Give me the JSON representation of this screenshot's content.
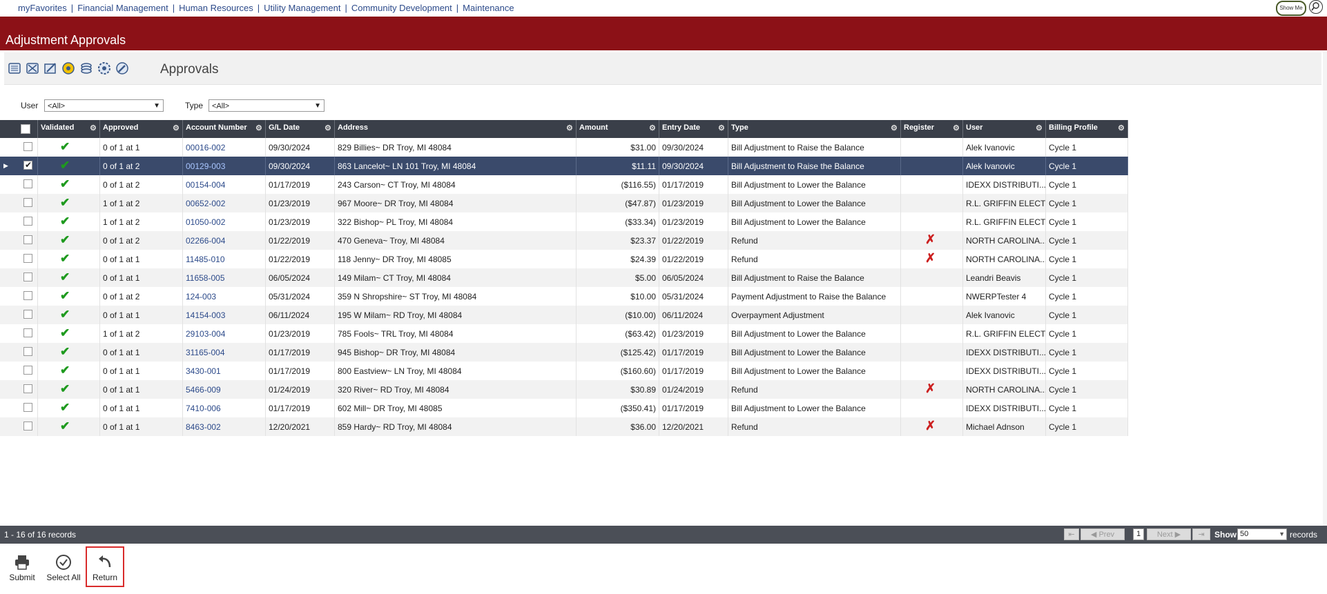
{
  "topnav": {
    "links": [
      "myFavorites",
      "Financial Management",
      "Human Resources",
      "Utility Management",
      "Community Development",
      "Maintenance"
    ],
    "show_me": "Show Me"
  },
  "title": "Adjustment Approvals",
  "toolbar": {
    "label": "Approvals",
    "icons": [
      "list-icon",
      "filter-icon",
      "edit-icon",
      "settings-icon",
      "stack-icon",
      "gear-icon",
      "tools-icon"
    ]
  },
  "filters": {
    "user_label": "User",
    "user_value": "<All>",
    "type_label": "Type",
    "type_value": "<All>"
  },
  "grid": {
    "columns": [
      "Validated",
      "Approved",
      "Account Number",
      "G/L Date",
      "Address",
      "Amount",
      "Entry Date",
      "Type",
      "Register",
      "User",
      "Billing Profile"
    ],
    "rows": [
      {
        "approved": "0 of 1 at 1",
        "account": "00016-002",
        "gl_date": "09/30/2024",
        "address": "829 Billies~ DR Troy, MI 48084",
        "amount": "$31.00",
        "entry_date": "09/30/2024",
        "type": "Bill Adjustment to Raise the Balance",
        "register_flag": false,
        "user": "Alek Ivanovic",
        "billing": "Cycle 1",
        "selected": false
      },
      {
        "approved": "0 of 1 at 2",
        "account": "00129-003",
        "gl_date": "09/30/2024",
        "address": "863 Lancelot~ LN 101 Troy, MI 48084",
        "amount": "$11.11",
        "entry_date": "09/30/2024",
        "type": "Bill Adjustment to Raise the Balance",
        "register_flag": false,
        "user": "Alek Ivanovic",
        "billing": "Cycle 1",
        "selected": true
      },
      {
        "approved": "0 of 1 at 2",
        "account": "00154-004",
        "gl_date": "01/17/2019",
        "address": "243 Carson~ CT Troy, MI 48084",
        "amount": "($116.55)",
        "entry_date": "01/17/2019",
        "type": "Bill Adjustment to Lower the Balance",
        "register_flag": false,
        "user": "IDEXX DISTRIBUTI...",
        "billing": "Cycle 1",
        "selected": false
      },
      {
        "approved": "1 of 1 at 2",
        "account": "00652-002",
        "gl_date": "01/23/2019",
        "address": "967 Moore~ DR Troy, MI 48084",
        "amount": "($47.87)",
        "entry_date": "01/23/2019",
        "type": "Bill Adjustment to Lower the Balance",
        "register_flag": false,
        "user": "R.L. GRIFFIN ELECTRI",
        "billing": "Cycle 1",
        "selected": false
      },
      {
        "approved": "1 of 1 at 2",
        "account": "01050-002",
        "gl_date": "01/23/2019",
        "address": "322 Bishop~ PL Troy, MI 48084",
        "amount": "($33.34)",
        "entry_date": "01/23/2019",
        "type": "Bill Adjustment to Lower the Balance",
        "register_flag": false,
        "user": "R.L. GRIFFIN ELECTRI",
        "billing": "Cycle 1",
        "selected": false
      },
      {
        "approved": "0 of 1 at 2",
        "account": "02266-004",
        "gl_date": "01/22/2019",
        "address": "470 Geneva~ Troy, MI 48084",
        "amount": "$23.37",
        "entry_date": "01/22/2019",
        "type": "Refund",
        "register_flag": true,
        "user": "NORTH CAROLINA...",
        "billing": "Cycle 1",
        "selected": false
      },
      {
        "approved": "0 of 1 at 1",
        "account": "11485-010",
        "gl_date": "01/22/2019",
        "address": "118 Jenny~ DR Troy, MI 48085",
        "amount": "$24.39",
        "entry_date": "01/22/2019",
        "type": "Refund",
        "register_flag": true,
        "user": "NORTH CAROLINA...",
        "billing": "Cycle 1",
        "selected": false
      },
      {
        "approved": "0 of 1 at 1",
        "account": "11658-005",
        "gl_date": "06/05/2024",
        "address": "149 Milam~ CT Troy, MI 48084",
        "amount": "$5.00",
        "entry_date": "06/05/2024",
        "type": "Bill Adjustment to Raise the Balance",
        "register_flag": false,
        "user": "Leandri Beavis",
        "billing": "Cycle 1",
        "selected": false
      },
      {
        "approved": "0 of 1 at 2",
        "account": "124-003",
        "gl_date": "05/31/2024",
        "address": "359 N Shropshire~ ST Troy, MI 48084",
        "amount": "$10.00",
        "entry_date": "05/31/2024",
        "type": "Payment Adjustment to Raise the Balance",
        "register_flag": false,
        "user": "NWERPTester 4",
        "billing": "Cycle 1",
        "selected": false
      },
      {
        "approved": "0 of 1 at 1",
        "account": "14154-003",
        "gl_date": "06/11/2024",
        "address": "195 W Milam~ RD Troy, MI 48084",
        "amount": "($10.00)",
        "entry_date": "06/11/2024",
        "type": "Overpayment Adjustment",
        "register_flag": false,
        "user": "Alek Ivanovic",
        "billing": "Cycle 1",
        "selected": false
      },
      {
        "approved": "1 of 1 at 2",
        "account": "29103-004",
        "gl_date": "01/23/2019",
        "address": "785 Fools~ TRL Troy, MI 48084",
        "amount": "($63.42)",
        "entry_date": "01/23/2019",
        "type": "Bill Adjustment to Lower the Balance",
        "register_flag": false,
        "user": "R.L. GRIFFIN ELECTRI",
        "billing": "Cycle 1",
        "selected": false
      },
      {
        "approved": "0 of 1 at 1",
        "account": "31165-004",
        "gl_date": "01/17/2019",
        "address": "945 Bishop~ DR Troy, MI 48084",
        "amount": "($125.42)",
        "entry_date": "01/17/2019",
        "type": "Bill Adjustment to Lower the Balance",
        "register_flag": false,
        "user": "IDEXX DISTRIBUTI...",
        "billing": "Cycle 1",
        "selected": false
      },
      {
        "approved": "0 of 1 at 1",
        "account": "3430-001",
        "gl_date": "01/17/2019",
        "address": "800 Eastview~ LN Troy, MI 48084",
        "amount": "($160.60)",
        "entry_date": "01/17/2019",
        "type": "Bill Adjustment to Lower the Balance",
        "register_flag": false,
        "user": "IDEXX DISTRIBUTI...",
        "billing": "Cycle 1",
        "selected": false
      },
      {
        "approved": "0 of 1 at 1",
        "account": "5466-009",
        "gl_date": "01/24/2019",
        "address": "320 River~ RD Troy, MI 48084",
        "amount": "$30.89",
        "entry_date": "01/24/2019",
        "type": "Refund",
        "register_flag": true,
        "user": "NORTH CAROLINA...",
        "billing": "Cycle 1",
        "selected": false
      },
      {
        "approved": "0 of 1 at 1",
        "account": "7410-006",
        "gl_date": "01/17/2019",
        "address": "602 Mill~ DR Troy, MI 48085",
        "amount": "($350.41)",
        "entry_date": "01/17/2019",
        "type": "Bill Adjustment to Lower the Balance",
        "register_flag": false,
        "user": "IDEXX DISTRIBUTI...",
        "billing": "Cycle 1",
        "selected": false
      },
      {
        "approved": "0 of 1 at 1",
        "account": "8463-002",
        "gl_date": "12/20/2021",
        "address": "859 Hardy~ RD Troy, MI 48084",
        "amount": "$36.00",
        "entry_date": "12/20/2021",
        "type": "Refund",
        "register_flag": true,
        "user": "Michael Adnson",
        "billing": "Cycle 1",
        "selected": false
      }
    ]
  },
  "pager": {
    "info": "1 - 16 of 16 records",
    "prev": "Prev",
    "next": "Next",
    "page": "1",
    "show_label": "Show",
    "show_value": "50",
    "records_label": "records"
  },
  "actions": {
    "submit": "Submit",
    "select_all": "Select All",
    "return": "Return"
  },
  "colors": {
    "title_bar": "#8c1117",
    "header": "#3a3f49",
    "selected_row": "#3a4a6b",
    "link": "#2c4a8a"
  }
}
